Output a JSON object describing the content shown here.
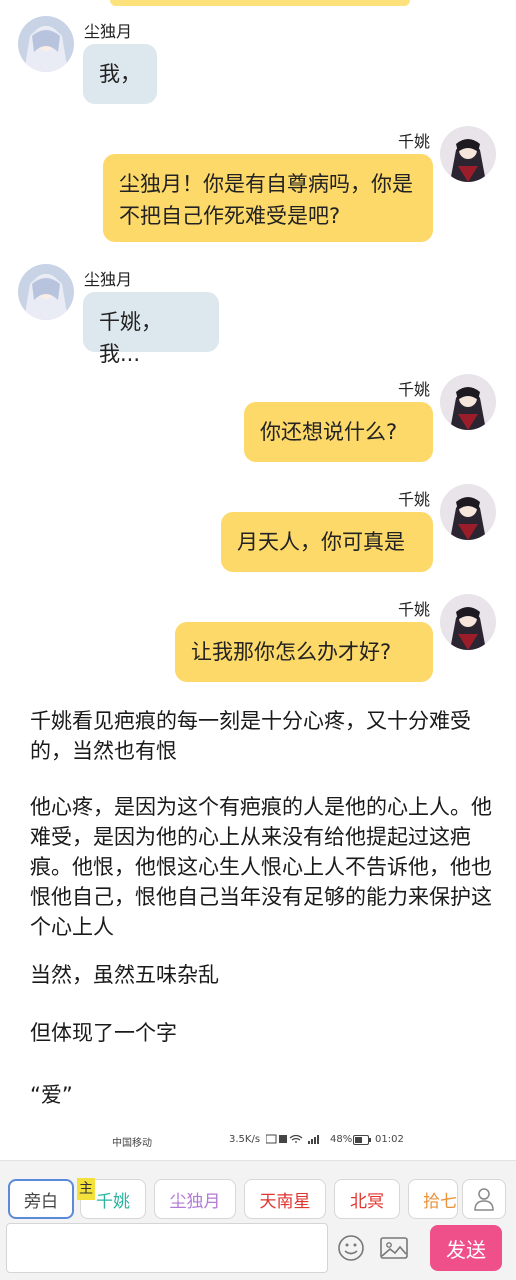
{
  "characters": {
    "left": "尘独月",
    "right": "千姚"
  },
  "messages": [
    {
      "speaker": "尘独月",
      "text": "我，"
    },
    {
      "speaker": "千姚",
      "text": "尘独月！你是有自尊病吗，你是不把自己作死难受是吧?"
    },
    {
      "speaker": "尘独月",
      "text": "千姚，我..."
    },
    {
      "speaker": "千姚",
      "text": "你还想说什么?"
    },
    {
      "speaker": "千姚",
      "text": "月天人，你可真是"
    },
    {
      "speaker": "千姚",
      "text": "让我那你怎么办才好?"
    }
  ],
  "narration": [
    "千姚看见疤痕的每一刻是十分心疼，又十分难受的，当然也有恨",
    "他心疼，是因为这个有疤痕的人是他的心上人。他难受，是因为他的心上从来没有给他提起过这疤痕。他恨，他恨这心生人恨心上人不告诉他，他也恨他自己，恨他自己当年没有足够的能力来保护这个心上人",
    "当然，虽然五味杂乱",
    "但体现了一个字",
    "“爱”"
  ],
  "status_bar": {
    "carrier": "中国移动",
    "speed": "3.5K/s",
    "battery": "48%",
    "time": "01:02"
  },
  "role_bar": {
    "main_tag": "主",
    "roles": [
      {
        "label": "旁白",
        "color": "#444444",
        "active": true
      },
      {
        "label": "千姚",
        "color": "#2bb3a0",
        "active": false
      },
      {
        "label": "尘独月",
        "color": "#b07ad6",
        "active": false
      },
      {
        "label": "天南星",
        "color": "#e0342f",
        "active": false
      },
      {
        "label": "北冥",
        "color": "#e0342f",
        "active": false
      },
      {
        "label": "拾七",
        "color": "#e9923a",
        "active": false
      }
    ]
  },
  "input": {
    "placeholder": "",
    "send_label": "发送"
  },
  "icons": {
    "person": "person-icon",
    "emoji": "emoji-icon",
    "image": "image-icon"
  }
}
